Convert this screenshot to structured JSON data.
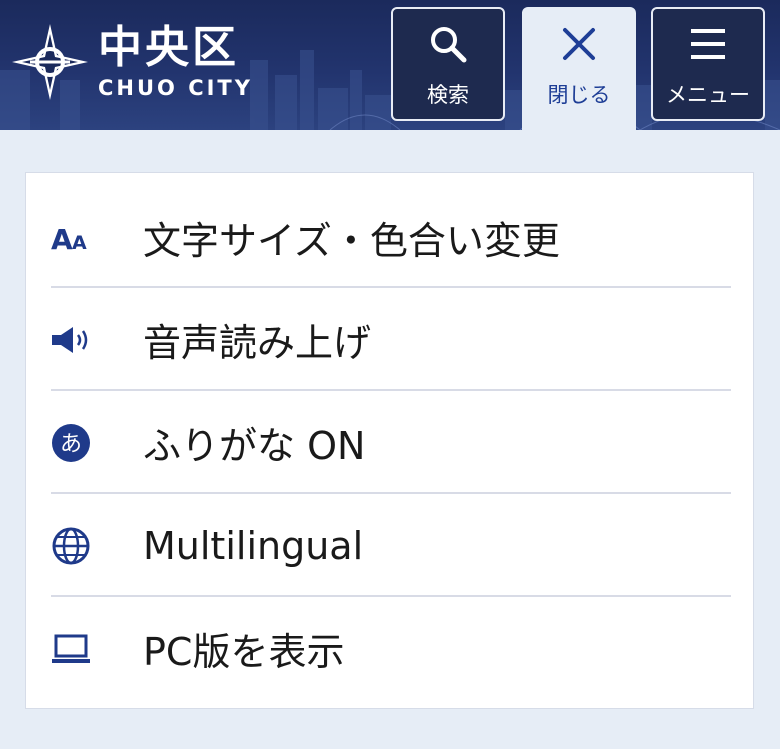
{
  "header": {
    "logo": {
      "title": "中央区",
      "subtitle": "CHUO CITY"
    },
    "buttons": {
      "search": {
        "label": "検索",
        "icon": "search-icon"
      },
      "close": {
        "label": "閉じる",
        "icon": "close-icon"
      },
      "menu": {
        "label": "メニュー",
        "icon": "hamburger-icon"
      }
    }
  },
  "menu": {
    "items": [
      {
        "label": "文字サイズ・色合い変更",
        "icon": "font-size-icon"
      },
      {
        "label": "音声読み上げ",
        "icon": "speaker-icon"
      },
      {
        "label": "ふりがな ON",
        "icon": "furigana-icon"
      },
      {
        "label": "Multilingual",
        "icon": "globe-icon"
      },
      {
        "label": "PC版を表示",
        "icon": "laptop-icon"
      }
    ]
  },
  "colors": {
    "header_bg": "#1b2a5c",
    "accent": "#1e3e96",
    "page_bg": "#e6edf6",
    "icon": "#1f3a8a"
  }
}
